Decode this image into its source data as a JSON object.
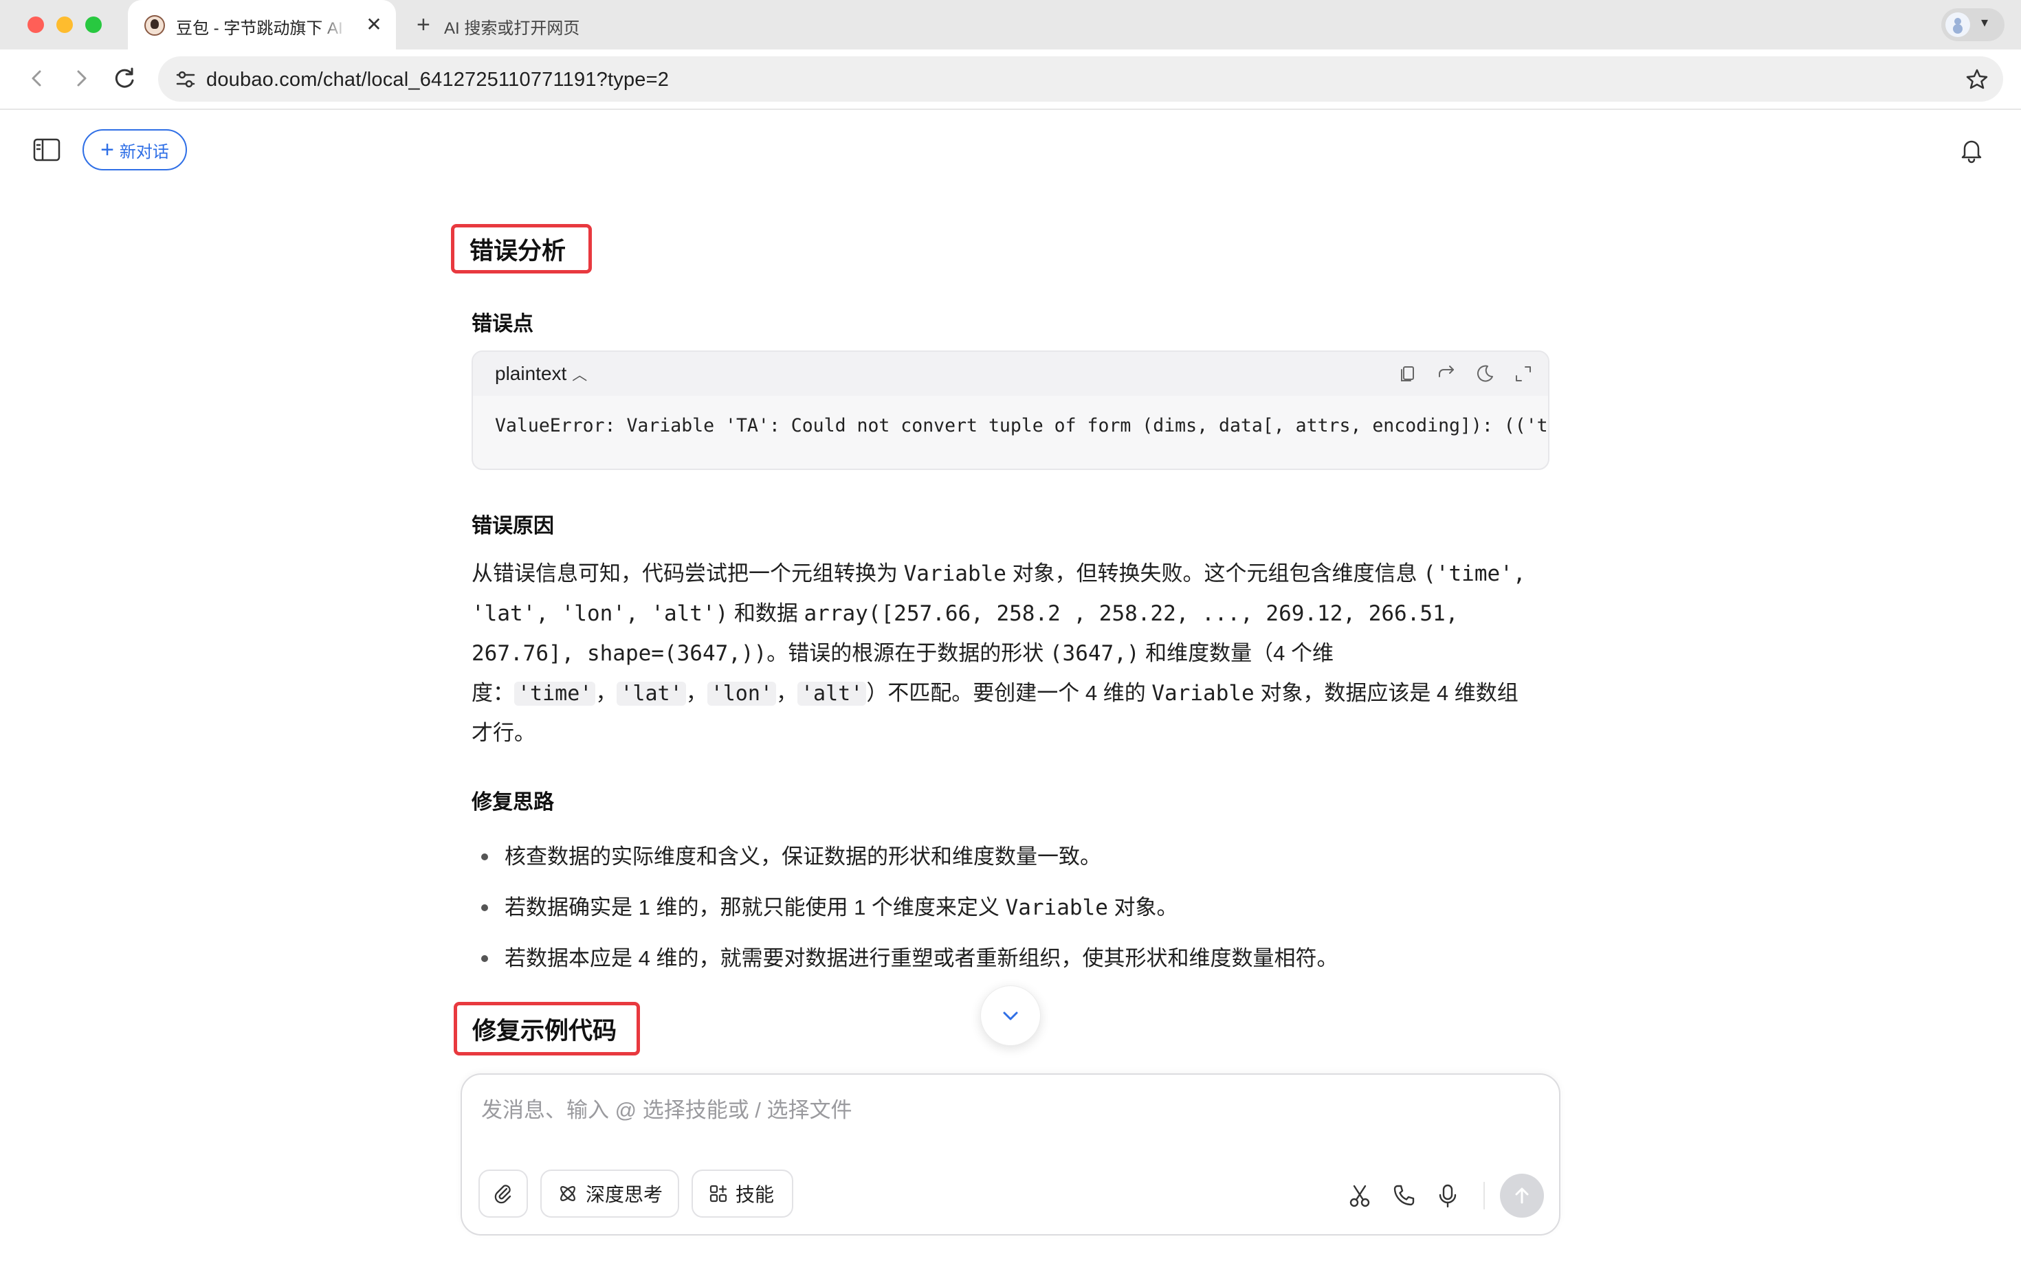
{
  "browser": {
    "tab_title": "豆包 - 字节跳动旗下 AI 智能助手",
    "tab_close": "✕",
    "new_tab_label": "AI 搜索或打开网页",
    "url": "doubao.com/chat/local_6412725110771191?type=2"
  },
  "header": {
    "new_chat_label": "新对话"
  },
  "article": {
    "heading_analysis": "错误分析",
    "sub_point": "错误点",
    "code": {
      "lang": "plaintext",
      "line": "ValueError: Variable 'TA': Could not convert tuple of form (dims, data[, attrs, encoding]): (('time', 'lat', 'lon', 'alt'), array([257.66, 258.2 , 258.22, ..., 269.12, 266.51, 267.76], shape=(3647,))) to Variable."
    },
    "sub_reason": "错误原因",
    "reason": {
      "t1": "从错误信息可知，代码尝试把一个元组转换为 ",
      "m1": "Variable",
      "t2": " 对象，但转换失败。这个元组包含维度信息 ",
      "m2": "('time', 'lat', 'lon', 'alt')",
      "t3": " 和数据 ",
      "m3": "array([257.66, 258.2 , 258.22, ..., 269.12, 266.51, 267.76], shape=(3647,))",
      "t4": "。错误的根源在于数据的形状 ",
      "m4": "(3647,)",
      "t5": " 和维度数量（4 个维度：",
      "c1": "'time'",
      "s1": "，",
      "c2": "'lat'",
      "s2": "，",
      "c3": "'lon'",
      "s3": "，",
      "c4": "'alt'",
      "t6": "）不匹配。要创建一个 4 维的 ",
      "m5": "Variable",
      "t7": " 对象，数据应该是 4 维数组才行。"
    },
    "sub_idea": "修复思路",
    "ideas": {
      "i1": "核查数据的实际维度和含义，保证数据的形状和维度数量一致。",
      "i2a": "若数据确实是 1 维的，那就只能使用 1 个维度来定义 ",
      "i2m": "Variable",
      "i2b": " 对象。",
      "i3": "若数据本应是 4 维的，就需要对数据进行重塑或者重新组织，使其形状和维度数量相符。"
    },
    "heading_fix": "修复示例代码"
  },
  "composer": {
    "placeholder": "发消息、输入 @ 选择技能或 / 选择文件",
    "deep_think_label": "深度思考",
    "skills_label": "技能"
  },
  "icons": {
    "tab_favicon": "doubao-avatar-icon",
    "profile": "profile-avatar-icon",
    "back": "arrow-left-icon",
    "forward": "arrow-right-icon",
    "reload": "reload-icon",
    "site_settings": "tune-icon",
    "bookmark": "star-icon",
    "sidebar": "sidebar-toggle-icon",
    "bell": "bell-icon",
    "copy": "copy-icon",
    "wrap": "wrap-icon",
    "theme": "moon-icon",
    "expand": "expand-icon",
    "scroll": "chevron-down-icon",
    "attach": "paperclip-icon",
    "deep_think": "atom-icon",
    "skills": "apps-icon",
    "cut": "scissors-icon",
    "call": "phone-icon",
    "mic": "microphone-icon",
    "send": "arrow-up-icon"
  },
  "colors": {
    "accent": "#2f6fe6",
    "highlight_box": "#e8393f",
    "send_disabled": "#d7d8dc"
  }
}
